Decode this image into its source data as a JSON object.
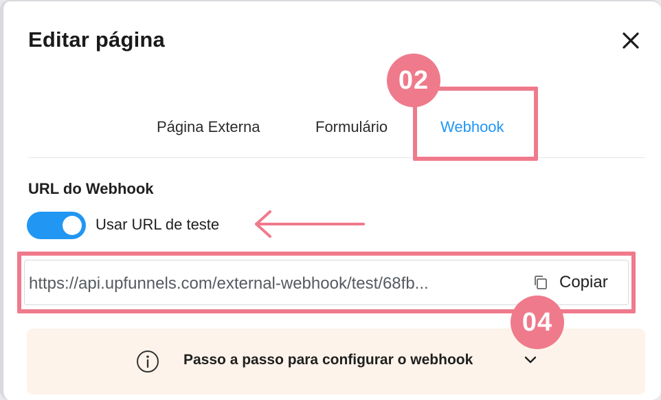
{
  "modal": {
    "title": "Editar página",
    "close_icon": "close-icon"
  },
  "tabs": [
    {
      "label": "Página Externa",
      "active": false
    },
    {
      "label": "Formulário",
      "active": false
    },
    {
      "label": "Webhook",
      "active": true
    }
  ],
  "webhook": {
    "section_label": "URL do Webhook",
    "toggle_label": "Usar URL de teste",
    "toggle_on": true,
    "url": "https://api.upfunnels.com/external-webhook/test/68fb...",
    "copy_label": "Copiar",
    "copy_icon": "copy-icon"
  },
  "info": {
    "text": "Passo a passo para configurar o webhook",
    "info_icon": "info-icon",
    "chevron_icon": "chevron-down-icon"
  },
  "annotations": {
    "badge_tabs": "02",
    "badge_url": "04",
    "arrow_icon": "arrow-left-icon"
  },
  "colors": {
    "accent": "#2196f3",
    "annotation": "#ef7a8b",
    "info_bg": "#fdf3ea"
  }
}
